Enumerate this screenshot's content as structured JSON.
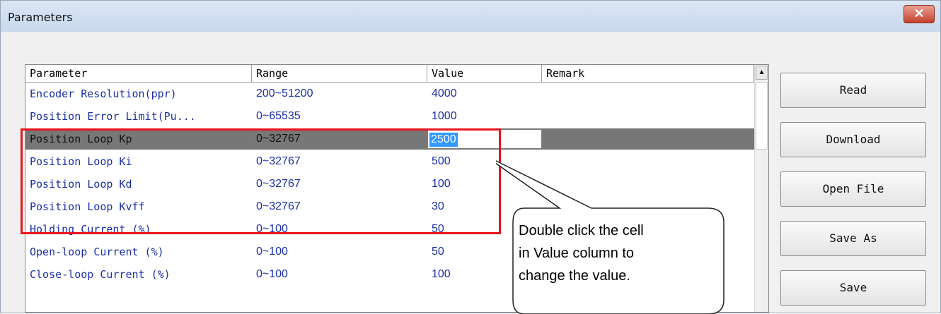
{
  "window": {
    "title": "Parameters",
    "close_label": "✕"
  },
  "grid": {
    "headers": [
      "Parameter",
      "Range",
      "Value",
      "Remark"
    ],
    "rows": [
      {
        "parameter": "Encoder Resolution(ppr)",
        "range": "200~51200",
        "value": "4000",
        "remark": ""
      },
      {
        "parameter": "Position Error Limit(Pu...",
        "range": "0~65535",
        "value": "1000",
        "remark": ""
      },
      {
        "parameter": "Position Loop Kp",
        "range": "0~32767",
        "value": "2500",
        "remark": ""
      },
      {
        "parameter": "Position Loop Ki",
        "range": "0~32767",
        "value": "500",
        "remark": ""
      },
      {
        "parameter": "Position Loop Kd",
        "range": "0~32767",
        "value": "100",
        "remark": ""
      },
      {
        "parameter": "Position Loop Kvff",
        "range": "0~32767",
        "value": "30",
        "remark": ""
      },
      {
        "parameter": "Holding Current (%)",
        "range": "0~100",
        "value": "50",
        "remark": ""
      },
      {
        "parameter": "Open-loop Current (%)",
        "range": "0~100",
        "value": "50",
        "remark": ""
      },
      {
        "parameter": "Close-loop Current (%)",
        "range": "0~100",
        "value": "100",
        "remark": ""
      }
    ],
    "selected_row": 2,
    "editing_value": "2500"
  },
  "buttons": {
    "read": "Read",
    "download": "Download",
    "open_file": "Open File",
    "save_as": "Save As",
    "save": "Save"
  },
  "callout": {
    "line1": "Double click the cell",
    "line2": "in Value column to",
    "line3": "change the value."
  },
  "colors": {
    "highlight_box": "#e8151d",
    "selected_row": "#777777",
    "text_link": "#1a2fa8"
  },
  "icons": {
    "scroll_up": "triangle-up-icon",
    "close": "close-icon"
  }
}
